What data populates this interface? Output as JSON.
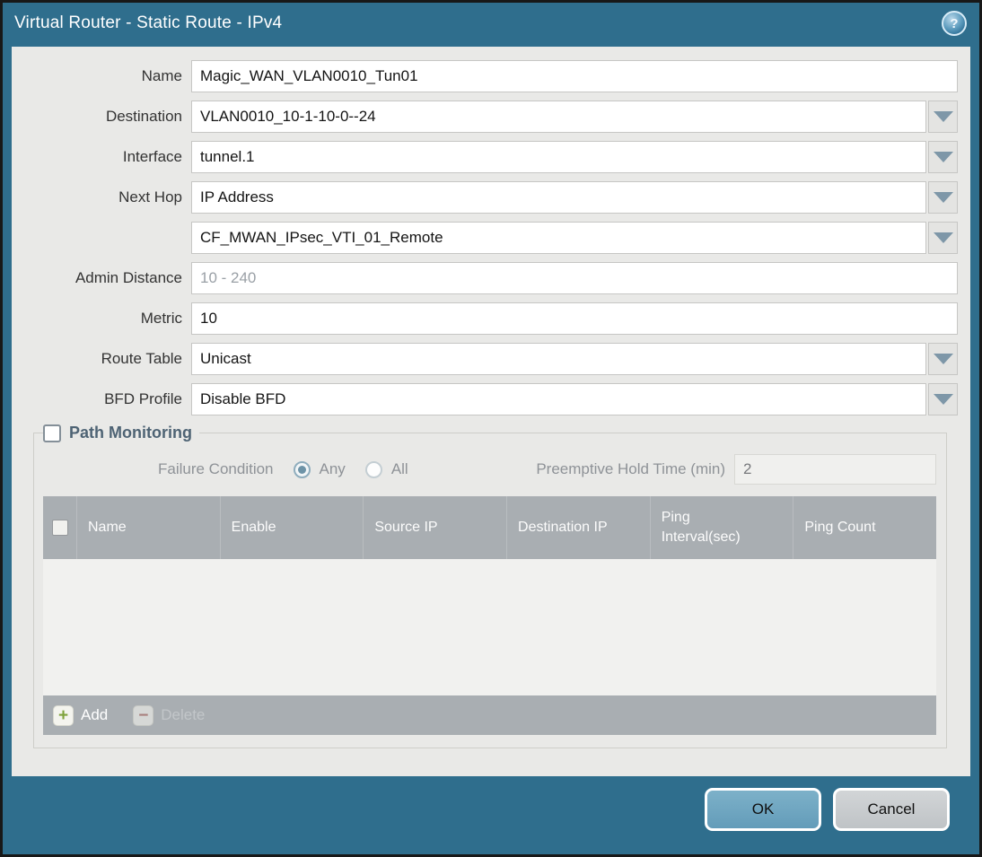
{
  "window": {
    "title": "Virtual Router - Static Route - IPv4",
    "help_glyph": "?"
  },
  "colors": {
    "titlebar_teal": "#2f6e8d",
    "ok_button_blue": "#6ba4c0",
    "cancel_button_gray": "#c7cacd",
    "table_header_gray": "#a9aeb2",
    "add_icon_green": "#7fa33c",
    "delete_icon_red": "#a8625a",
    "legend_slate": "#4e6374"
  },
  "form": {
    "fields": [
      {
        "label": "Name",
        "value": "Magic_WAN_VLAN0010_Tun01"
      },
      {
        "label": "Destination",
        "value": "VLAN0010_10-1-10-0--24"
      },
      {
        "label": "Interface",
        "value": "tunnel.1"
      },
      {
        "label": "Next Hop",
        "value": "IP Address"
      },
      {
        "label": "",
        "value": "CF_MWAN_IPsec_VTI_01_Remote"
      },
      {
        "label": "Admin Distance",
        "value": "",
        "placeholder": "10 - 240"
      },
      {
        "label": "Metric",
        "value": "10"
      },
      {
        "label": "Route Table",
        "value": "Unicast"
      },
      {
        "label": "BFD Profile",
        "value": "Disable BFD"
      }
    ]
  },
  "path_monitoring": {
    "legend": "Path Monitoring",
    "checked": false,
    "failure_condition_label": "Failure Condition",
    "radio_any": "Any",
    "radio_all": "All",
    "selected_condition": "Any",
    "preemptive_label": "Preemptive Hold Time (min)",
    "preemptive_value": "2",
    "table": {
      "columns": [
        "Name",
        "Enable",
        "Source IP",
        "Destination IP",
        "Ping Interval(sec)",
        "Ping Count"
      ],
      "rows": [],
      "add_label": "Add",
      "delete_label": "Delete"
    }
  },
  "actions": {
    "ok": "OK",
    "cancel": "Cancel"
  }
}
